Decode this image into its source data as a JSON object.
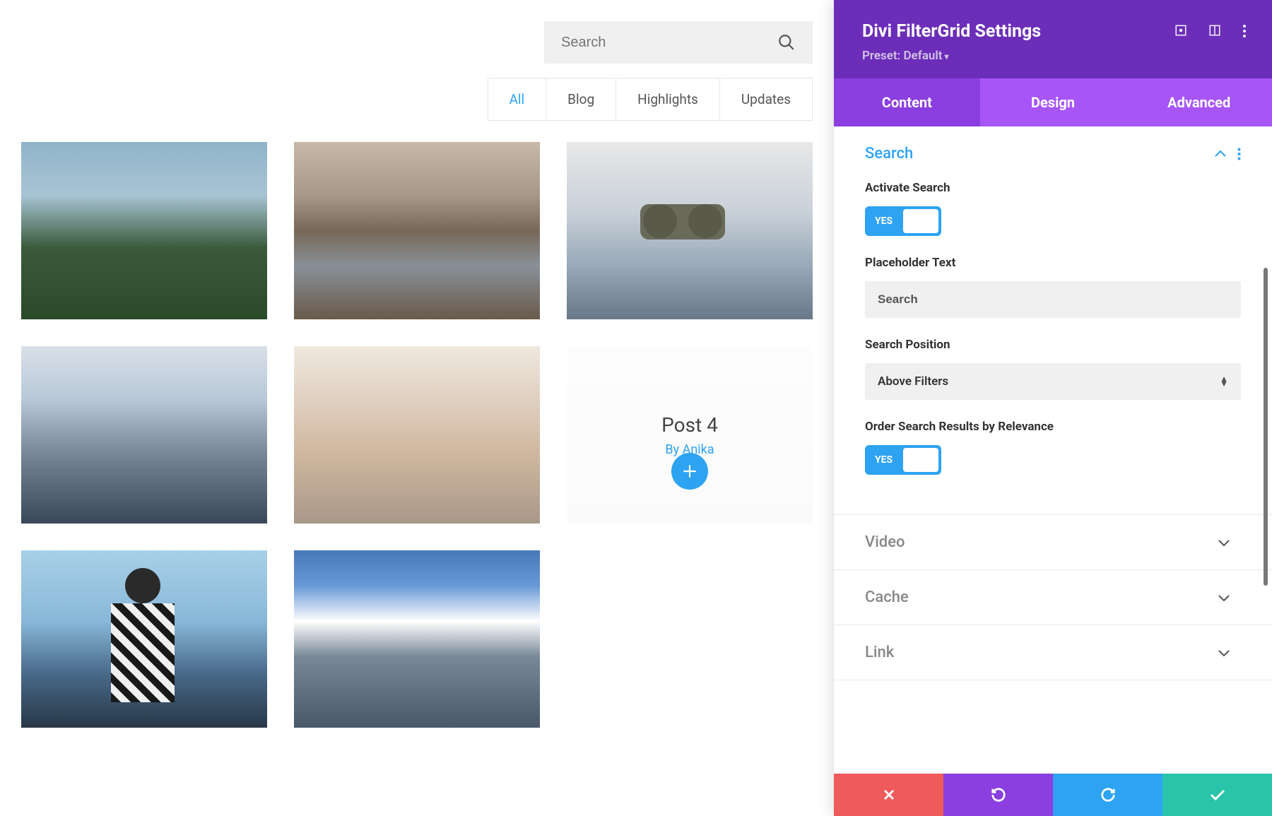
{
  "search": {
    "placeholder": "Search"
  },
  "filters": [
    "All",
    "Blog",
    "Highlights",
    "Updates"
  ],
  "active_filter": "All",
  "overlay": {
    "title": "Post 4",
    "author": "By Anika"
  },
  "panel": {
    "title": "Divi FilterGrid Settings",
    "preset_label": "Preset: Default",
    "tabs": [
      "Content",
      "Design",
      "Advanced"
    ],
    "active_tab": "Content",
    "sections": {
      "search": {
        "title": "Search",
        "activate_label": "Activate Search",
        "activate_value": "YES",
        "placeholder_label": "Placeholder Text",
        "placeholder_value": "Search",
        "position_label": "Search Position",
        "position_value": "Above Filters",
        "order_label": "Order Search Results by Relevance",
        "order_value": "YES"
      },
      "video": {
        "title": "Video"
      },
      "cache": {
        "title": "Cache"
      },
      "link": {
        "title": "Link"
      }
    }
  }
}
